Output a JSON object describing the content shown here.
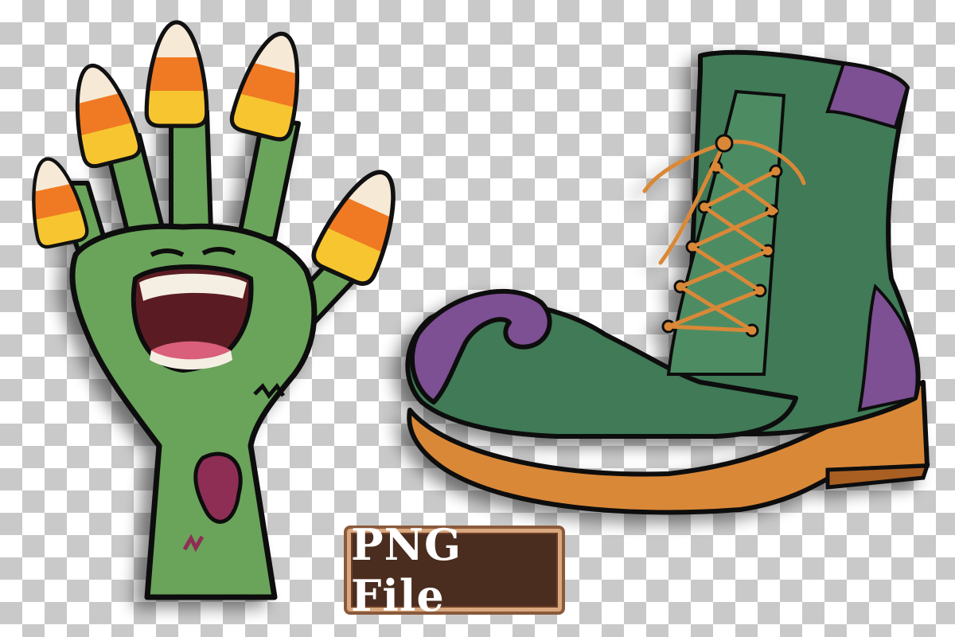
{
  "badge": {
    "label": "PNG File"
  },
  "colors": {
    "checker_dark": "#c9c9c9",
    "checker_light": "#ffffff",
    "zombie_green": "#6aa35a",
    "candy_orange": "#f07a23",
    "candy_yellow": "#f7c530",
    "candy_white": "#f6e9d6",
    "boot_green": "#3f7a56",
    "boot_purple": "#7d4f93",
    "boot_sole": "#d98838",
    "badge_bg": "#4a2d1f",
    "badge_border": "#d9a87e"
  },
  "icons": [
    "zombie-hand-icon",
    "candy-corn-icon",
    "witch-boot-icon"
  ]
}
